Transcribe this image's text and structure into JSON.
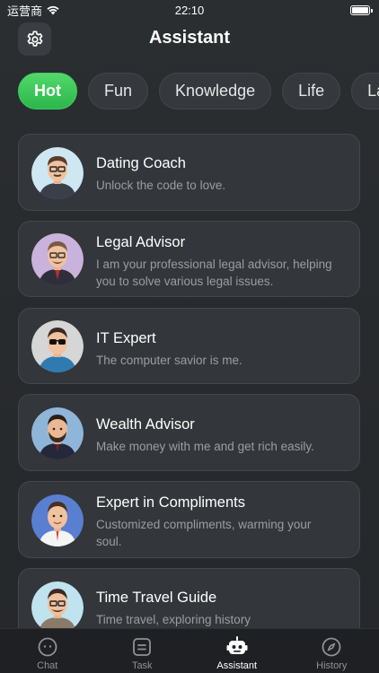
{
  "status_bar": {
    "carrier": "运营商",
    "time": "22:10"
  },
  "header": {
    "title": "Assistant",
    "settings_icon": "gear-icon"
  },
  "tabs": [
    {
      "label": "Hot",
      "active": true
    },
    {
      "label": "Fun",
      "active": false
    },
    {
      "label": "Knowledge",
      "active": false
    },
    {
      "label": "Life",
      "active": false
    },
    {
      "label": "La",
      "active": false
    }
  ],
  "assistants": [
    {
      "title": "Dating Coach",
      "desc": "Unlock the code to love."
    },
    {
      "title": "Legal Advisor",
      "desc": "I am your professional legal advisor, helping you to solve various legal issues."
    },
    {
      "title": "IT Expert",
      "desc": "The computer savior is me."
    },
    {
      "title": "Wealth Advisor",
      "desc": "Make money with me and get rich easily."
    },
    {
      "title": "Expert in Compliments",
      "desc": "Customized compliments, warming your soul."
    },
    {
      "title": "Time Travel Guide",
      "desc": "Time travel, exploring history"
    }
  ],
  "tabbar": [
    {
      "label": "Chat",
      "icon": "chat-icon",
      "active": false
    },
    {
      "label": "Task",
      "icon": "task-icon",
      "active": false
    },
    {
      "label": "Assistant",
      "icon": "robot-icon",
      "active": true
    },
    {
      "label": "History",
      "icon": "compass-icon",
      "active": false
    }
  ],
  "colors": {
    "accent": "#3fcb5b",
    "background": "#2b2e31",
    "card": "#33363a"
  }
}
